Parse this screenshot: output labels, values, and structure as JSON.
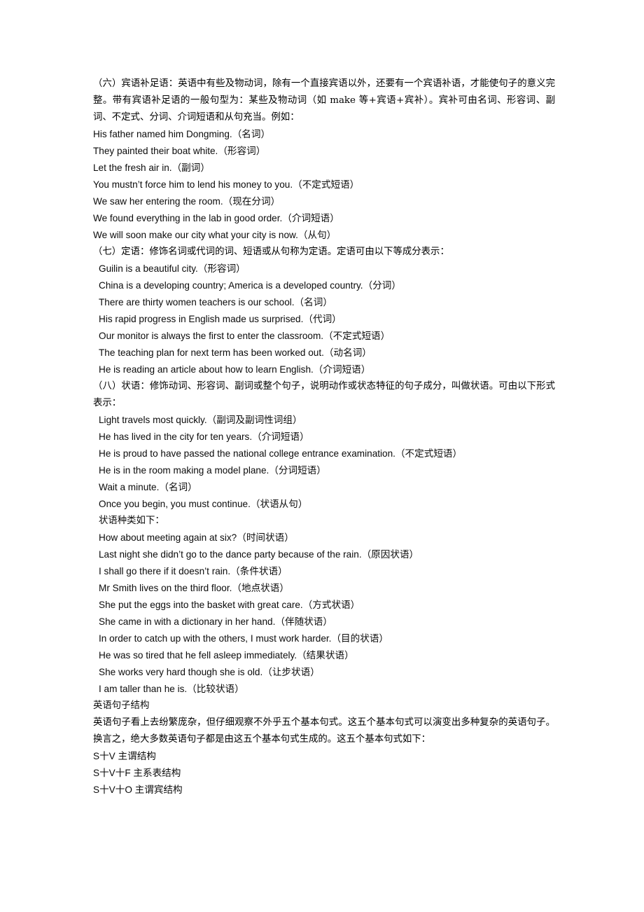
{
  "document": {
    "background_color": "#ffffff",
    "text_color": "#0b0b0b",
    "sections": {
      "six": {
        "body": "（六）宾语补足语：英语中有些及物动词，除有一个直接宾语以外，还要有一个宾语补语，才能使句子的意义完整。带有宾语补足语的一般句型为：某些及物动词（如 make 等+宾语+宾补）。宾补可由名词、形容词、副词、不定式、分词、介词短语和从句充当。例如：",
        "examples": [
          "His father named him Dongming.（名词）",
          "They painted their boat white.（形容词）",
          "Let the fresh air in.（副词）",
          "You mustn’t force him to lend his money to you.（不定式短语）",
          "We saw her entering the room.（现在分词）",
          "We found everything in the lab in good order.（介词短语）",
          "We will soon make our city what your city is now.（从句）"
        ]
      },
      "seven": {
        "body": "（七）定语：修饰名词或代词的词、短语或从句称为定语。定语可由以下等成分表示：",
        "examples": [
          "Guilin is a beautiful city.（形容词）",
          "China is a developing country; America is a developed country.（分词）",
          "There are thirty women teachers is our school.（名词）",
          "His rapid progress in English made us surprised.（代词）",
          "Our monitor is always the first to enter the classroom.（不定式短语）",
          "The teaching plan for next term has been worked out.（动名词）",
          "He is reading an article about how to learn English.（介词短语）"
        ]
      },
      "eight": {
        "body": "（八）状语：修饰动词、形容词、副词或整个句子，说明动作或状态特征的句子成分，叫做状语。可由以下形式表示：",
        "examples": [
          "Light travels most quickly.（副词及副词性词组）",
          "He has lived in the city for ten years.（介词短语）",
          "He is proud to have passed the national college entrance examination.（不定式短语）",
          "He is in the room making a model plane.（分词短语）",
          "Wait a minute.（名词）",
          "Once you begin, you must continue.（状语从句）"
        ],
        "types_intro": "状语种类如下：",
        "types": [
          "How about meeting again at six?（时间状语）",
          "Last night she didn’t go to the dance party because of the rain.（原因状语）",
          "I shall go there if it doesn’t rain.（条件状语）",
          "Mr Smith lives on the third floor.（地点状语）",
          "She put the eggs into the basket with great care.（方式状语）",
          "She came in with a dictionary in her hand.（伴随状语）",
          "In order to catch up with the others, I must work harder.（目的状语）",
          "He was so tired that he fell asleep immediately.（结果状语）",
          "She works very hard though she is old.（让步状语）",
          "I am taller than he is.（比较状语）"
        ]
      },
      "sentence_structure": {
        "title": "英语句子结构",
        "body": "英语句子看上去纷繁庞杂，但仔细观察不外乎五个基本句式。这五个基本句式可以演变出多种复杂的英语句子。换言之，绝大多数英语句子都是由这五个基本句式生成的。这五个基本句式如下：",
        "patterns": [
          "S十V 主谓结构",
          "S十V十F 主系表结构",
          "S十V十O 主谓宾结构"
        ]
      }
    }
  }
}
